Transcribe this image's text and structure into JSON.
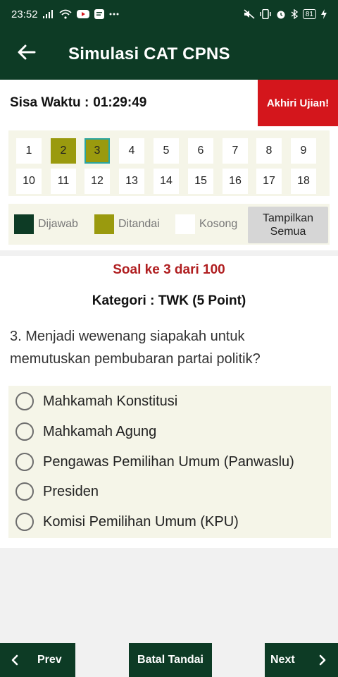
{
  "status_bar": {
    "time": "23:52",
    "battery": "81",
    "icons": [
      "signal-icon",
      "wifi-icon",
      "youtube-icon",
      "message-icon",
      "more-notifications-icon",
      "mute-icon",
      "vibrate-icon",
      "alarm-icon",
      "bluetooth-icon",
      "battery-icon",
      "charging-icon"
    ]
  },
  "app_bar": {
    "title": "Simulasi CAT CPNS",
    "back_icon": "arrow-left-icon"
  },
  "timer": {
    "label": "Sisa Waktu :",
    "value": "01:29:49",
    "end_button": "Akhiri Ujian!"
  },
  "navigator": {
    "row1": [
      {
        "n": "1",
        "state": "empty"
      },
      {
        "n": "2",
        "state": "marked"
      },
      {
        "n": "3",
        "state": "marked-current"
      },
      {
        "n": "4",
        "state": "empty"
      },
      {
        "n": "5",
        "state": "empty"
      },
      {
        "n": "6",
        "state": "empty"
      },
      {
        "n": "7",
        "state": "empty"
      },
      {
        "n": "8",
        "state": "empty"
      },
      {
        "n": "9",
        "state": "empty"
      }
    ],
    "row2": [
      {
        "n": "10",
        "state": "empty"
      },
      {
        "n": "11",
        "state": "empty"
      },
      {
        "n": "12",
        "state": "empty"
      },
      {
        "n": "13",
        "state": "empty"
      },
      {
        "n": "14",
        "state": "empty"
      },
      {
        "n": "15",
        "state": "empty"
      },
      {
        "n": "16",
        "state": "empty"
      },
      {
        "n": "17",
        "state": "empty"
      },
      {
        "n": "18",
        "state": "empty"
      }
    ]
  },
  "legend": {
    "answered": "Dijawab",
    "marked": "Ditandai",
    "empty": "Kosong",
    "show_all_line1": "Tampilkan",
    "show_all_line2": "Semua"
  },
  "question": {
    "number_label": "Soal ke 3 dari 100",
    "category": "Kategori : TWK (5 Point)",
    "text": "3. Menjadi wewenang siapakah untuk memutuskan pembubaran partai politik?",
    "options": [
      "Mahkamah Konstitusi",
      "Mahkamah Agung",
      "Pengawas Pemilihan Umum (Panwaslu)",
      "Presiden",
      "Komisi Pemilihan Umum (KPU)"
    ],
    "selected": null
  },
  "bottom_nav": {
    "prev": "Prev",
    "cancel_mark": "Batal Tandai",
    "next": "Next"
  },
  "colors": {
    "primary": "#0d3b25",
    "danger": "#d4161c",
    "marked": "#9a9a0e",
    "question_number": "#b01e20",
    "panel_bg": "#f5f5e8"
  }
}
